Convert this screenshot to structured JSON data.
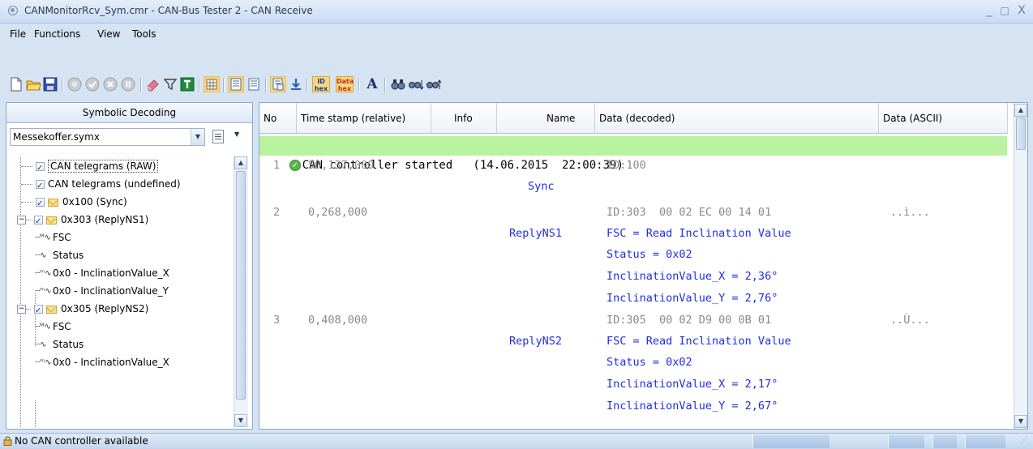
{
  "window": {
    "title": "CANMonitorRcv_Sym.cmr - CAN-Bus Tester 2 - CAN Receive",
    "controls": [
      "_",
      "□",
      "X"
    ]
  },
  "menu": [
    {
      "label": "File",
      "mnemonic": "F"
    },
    {
      "label": "Functions",
      "mnemonic": "u"
    },
    {
      "label": "View",
      "mnemonic": "V"
    },
    {
      "label": "Tools",
      "mnemonic": "T"
    }
  ],
  "toolbar": {
    "icons": [
      "new-file-icon",
      "open-folder-icon",
      "save-icon",
      "record-icon",
      "check-icon",
      "stop-icon",
      "pause-icon",
      "eraser-icon",
      "filter-icon",
      "t-icon",
      "grid-icon",
      "list-view-icon",
      "list-view-2-icon",
      "symbolic-view-icon",
      "download-icon",
      "id-hex-icon",
      "data-hex-icon",
      "font-icon",
      "find-icon",
      "find-next-icon",
      "find-prev-icon"
    ],
    "id_hex_label": [
      "ID",
      "hex"
    ],
    "data_hex_label": [
      "Data",
      "hex"
    ],
    "font_label": "A"
  },
  "left_panel": {
    "header": "Symbolic Decoding",
    "database_file": "Messekoffer.symx",
    "tree": [
      {
        "label": "CAN telegrams (RAW)",
        "checked": true
      },
      {
        "label": "CAN telegrams (undefined)",
        "checked": true
      },
      {
        "label": "0x100 (Sync)",
        "checked": true,
        "envelope": true
      },
      {
        "label": "0x303 (ReplyNS1)",
        "checked": true,
        "envelope": true,
        "expanded": true
      },
      {
        "label": "FSC",
        "signal": "M"
      },
      {
        "label": "Status",
        "signal": "~"
      },
      {
        "label": "0x0 - InclinationValue_X",
        "signal": "m"
      },
      {
        "label": "0x0 - InclinationValue_Y",
        "signal": "m"
      },
      {
        "label": "0x305 (ReplyNS2)",
        "checked": true,
        "envelope": true,
        "expanded": true
      },
      {
        "label": "FSC",
        "signal": "M"
      },
      {
        "label": "Status",
        "signal": "~"
      },
      {
        "label": "0x0 - InclinationValue_X",
        "signal": "m"
      }
    ]
  },
  "grid": {
    "columns": [
      "No",
      "Time stamp (relative)",
      "Info",
      "Name",
      "Data (decoded)",
      "Data (ASCII)"
    ],
    "status_line": "CAN controller started   (14.06.2015  22:00:39)",
    "rows": [
      {
        "no": "1",
        "time": "50,137,000",
        "name": "",
        "data": "ID:100",
        "ascii": ""
      },
      {
        "no": "",
        "time": "",
        "name": "Sync",
        "data": "",
        "ascii": ""
      },
      {
        "no": "2",
        "time": "0,268,000",
        "name": "",
        "data": "ID:303  00 02 EC 00 14 01",
        "ascii": "..ì..."
      },
      {
        "no": "",
        "time": "",
        "name": "ReplyNS1",
        "data": "FSC = Read Inclination Value",
        "ascii": ""
      },
      {
        "no": "",
        "time": "",
        "name": "",
        "data": "Status = 0x02",
        "ascii": ""
      },
      {
        "no": "",
        "time": "",
        "name": "",
        "data": "InclinationValue_X = 2,36°",
        "ascii": ""
      },
      {
        "no": "",
        "time": "",
        "name": "",
        "data": "InclinationValue_Y = 2,76°",
        "ascii": ""
      },
      {
        "no": "3",
        "time": "0,408,000",
        "name": "",
        "data": "ID:305  00 02 D9 00 0B 01",
        "ascii": "..Ù..."
      },
      {
        "no": "",
        "time": "",
        "name": "ReplyNS2",
        "data": "FSC = Read Inclination Value",
        "ascii": ""
      },
      {
        "no": "",
        "time": "",
        "name": "",
        "data": "Status = 0x02",
        "ascii": ""
      },
      {
        "no": "",
        "time": "",
        "name": "",
        "data": "InclinationValue_X = 2,17°",
        "ascii": ""
      },
      {
        "no": "",
        "time": "",
        "name": "",
        "data": "InclinationValue_Y = 2,67°",
        "ascii": ""
      }
    ]
  },
  "statusbar": {
    "text": "No CAN controller available"
  },
  "colors": {
    "started_bg": "#b8f3a0",
    "decoded_text": "#1f2fe0",
    "raw_text": "#8a8a8a"
  }
}
